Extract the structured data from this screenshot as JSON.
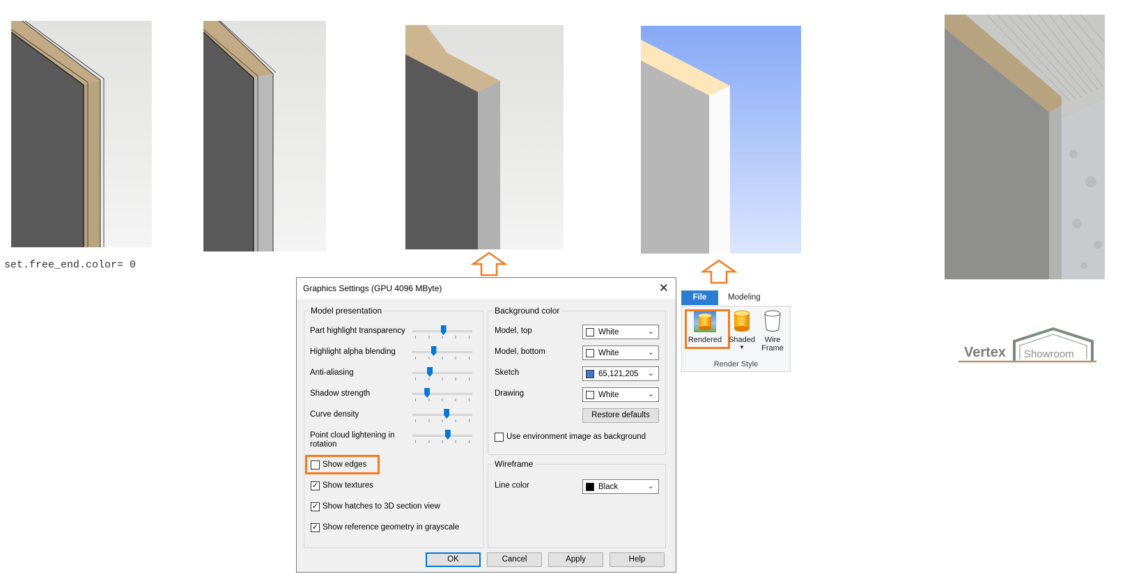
{
  "code_text": "set.free_end.color= 0",
  "dialog": {
    "title": "Graphics Settings (GPU 4096 MByte)",
    "close_icon": "close-icon",
    "model_presentation": {
      "label": "Model presentation",
      "sliders": [
        {
          "label": "Part highlight transparency",
          "level": 0.52
        },
        {
          "label": "Highlight alpha blending",
          "level": 0.34
        },
        {
          "label": "Anti-aliasing",
          "level": 0.27
        },
        {
          "label": "Shadow strength",
          "level": 0.22
        },
        {
          "label": "Curve density",
          "level": 0.58
        },
        {
          "label": "Point cloud lightening in rotation",
          "level": 0.6
        }
      ],
      "checkboxes": [
        {
          "label": "Show edges",
          "checked": false
        },
        {
          "label": "Show textures",
          "checked": true
        },
        {
          "label": "Show hatches to 3D section view",
          "checked": true
        },
        {
          "label": "Show reference geometry in grayscale",
          "checked": true
        }
      ]
    },
    "background_color": {
      "label": "Background color",
      "rows": [
        {
          "label": "Model, top",
          "value": "White",
          "swatch": "#ffffff"
        },
        {
          "label": "Model, bottom",
          "value": "White",
          "swatch": "#ffffff"
        },
        {
          "label": "Sketch",
          "value": "65,121,205",
          "swatch": "#4179cd"
        },
        {
          "label": "Drawing",
          "value": "White",
          "swatch": "#ffffff"
        }
      ],
      "restore_defaults": "Restore defaults",
      "env_image": {
        "label": "Use environment image as background",
        "checked": false
      }
    },
    "wireframe": {
      "label": "Wireframe",
      "line_color_label": "Line color",
      "line_color_value": "Black",
      "line_color_swatch": "#000000"
    },
    "buttons": {
      "ok": "OK",
      "cancel": "Cancel",
      "apply": "Apply",
      "help": "Help"
    }
  },
  "ribbon": {
    "tabs": [
      "File",
      "Modeling"
    ],
    "buttons": [
      {
        "label": "Rendered",
        "icon": "rendered-cylinder-icon"
      },
      {
        "label": "Shaded",
        "icon": "shaded-cylinder-icon"
      },
      {
        "label": "Wire Frame",
        "icon": "wireframe-cylinder-icon"
      }
    ],
    "group_label": "Render Style"
  },
  "logo": {
    "word": "Vertex",
    "sub": "Showroom"
  },
  "colors": {
    "highlight": "#f47b20",
    "accent": "#0078d7",
    "file_tab": "#2b7cd3"
  }
}
